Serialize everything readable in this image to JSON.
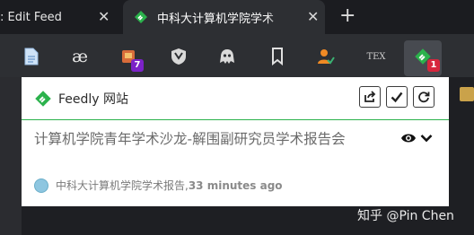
{
  "tabs": [
    {
      "title": ": Edit Feed",
      "close": "✕"
    },
    {
      "title": "中科大计算机学院学术",
      "close": "✕"
    }
  ],
  "new_tab": "+",
  "toolbar": {
    "badges": {
      "ext3": "7",
      "feedly": "1"
    },
    "tex_label": "TEX"
  },
  "popup": {
    "title": "Feedly 网站",
    "article": {
      "title": "计算机学院青年学术沙龙-解围副研究员学术报告会",
      "source": "中科大计算机学院学术报告, ",
      "time": "33 minutes ago"
    }
  },
  "watermark": "知乎 @Pin Chen",
  "colors": {
    "feedly_green": "#2bb24c",
    "badge_purple": "#7c22c8",
    "badge_red": "#d7263d"
  }
}
